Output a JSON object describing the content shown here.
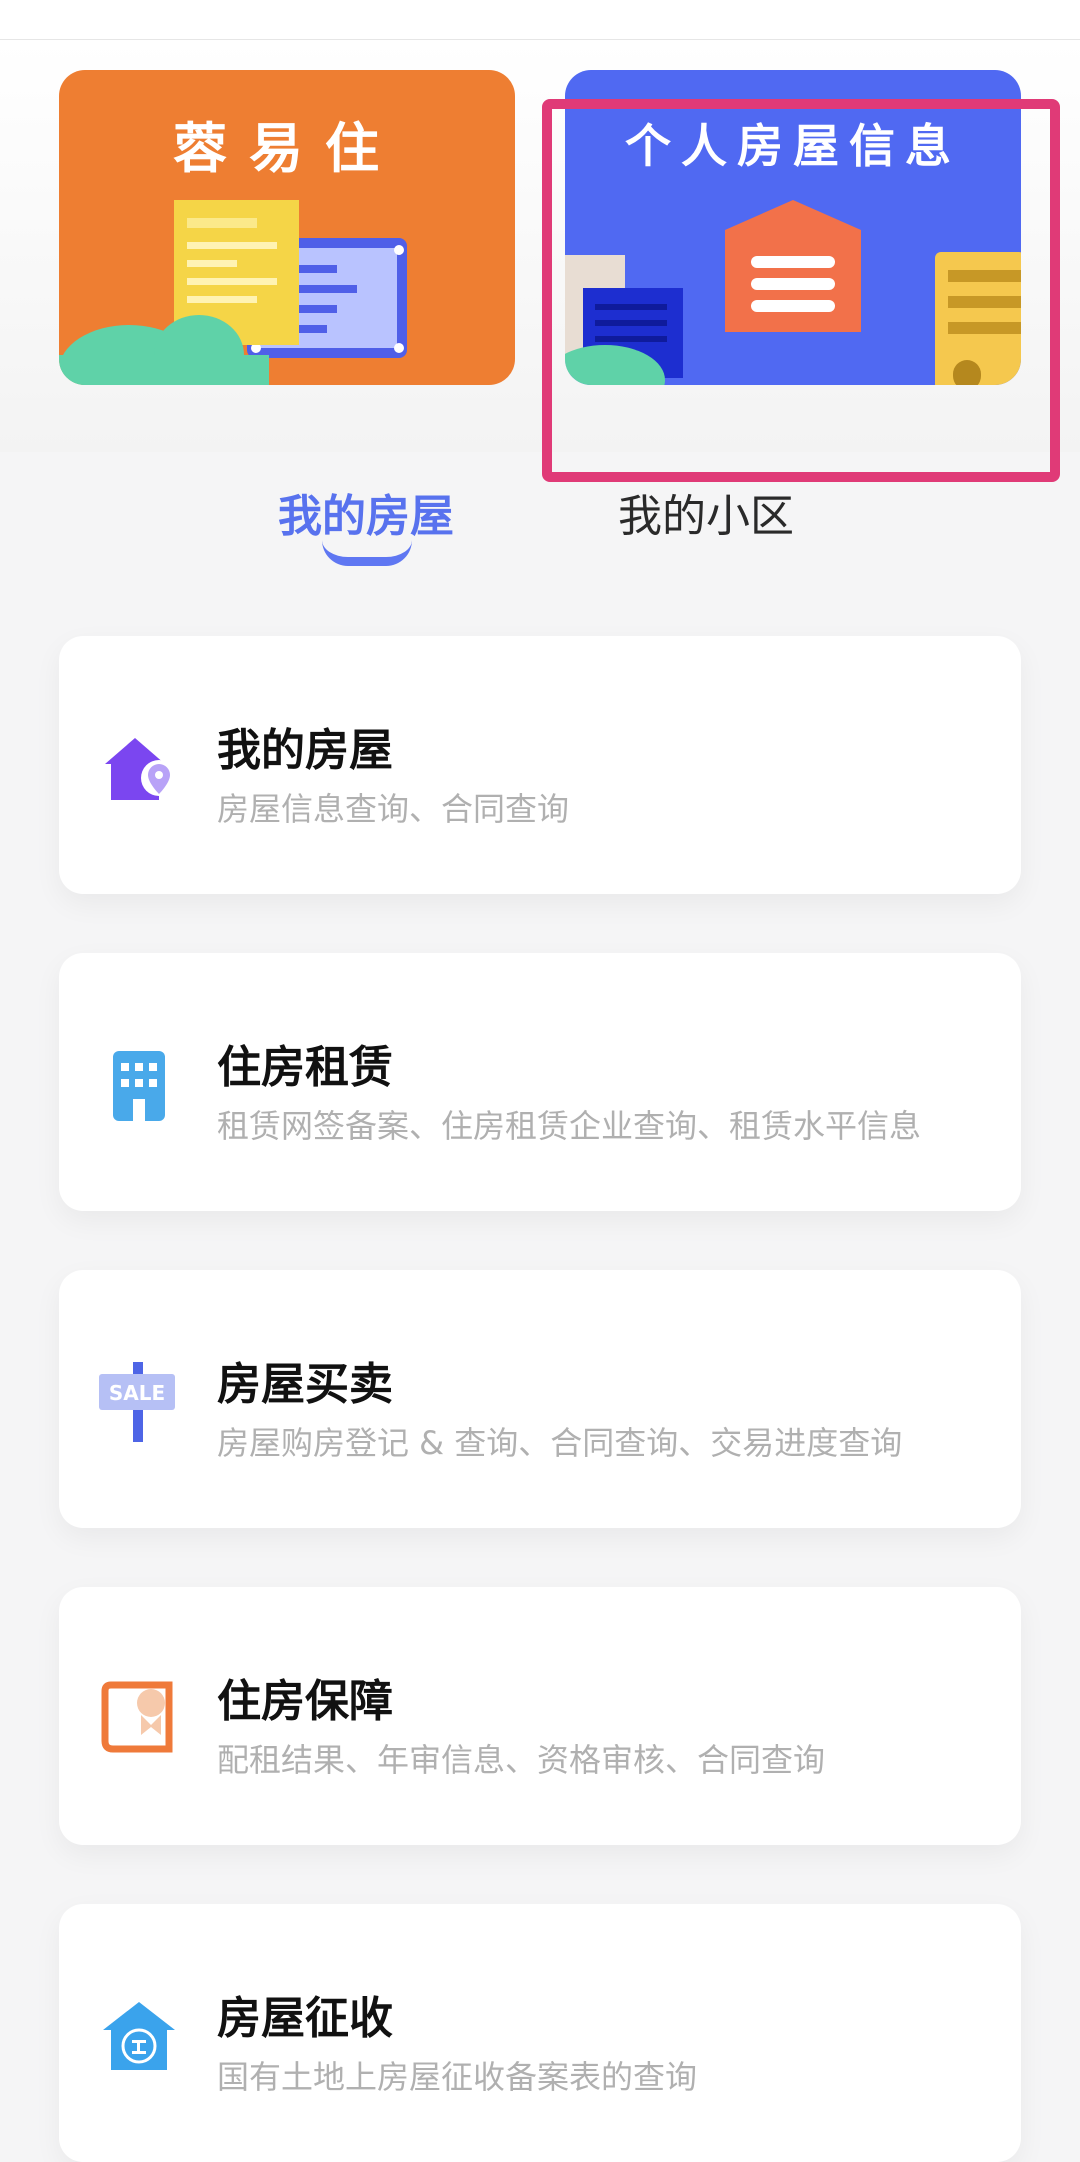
{
  "banners": {
    "rongyizhu_title": "蓉易住",
    "personal_title": "个人房屋信息"
  },
  "tabs": {
    "my_house": "我的房屋",
    "my_community": "我的小区"
  },
  "cards": [
    {
      "title": "我的房屋",
      "subtitle": "房屋信息查询、合同查询",
      "icon": "house-location-icon"
    },
    {
      "title": "住房租赁",
      "subtitle": "租赁网签备案、住房租赁企业查询、租赁水平信息",
      "icon": "building-icon"
    },
    {
      "title": "房屋买卖",
      "subtitle": "房屋购房登记 & 查询、合同查询、交易进度查询",
      "icon": "sale-sign-icon"
    },
    {
      "title": "住房保障",
      "subtitle": "配租结果、年审信息、资格审核、合同查询",
      "icon": "certificate-icon"
    },
    {
      "title": "房屋征收",
      "subtitle": "国有土地上房屋征收备案表的查询",
      "icon": "house-expropriation-icon"
    }
  ],
  "colors": {
    "orange_banner": "#ee7e32",
    "blue_banner": "#5069f2",
    "active_tab": "#5872ee",
    "highlight": "#e03a77"
  }
}
